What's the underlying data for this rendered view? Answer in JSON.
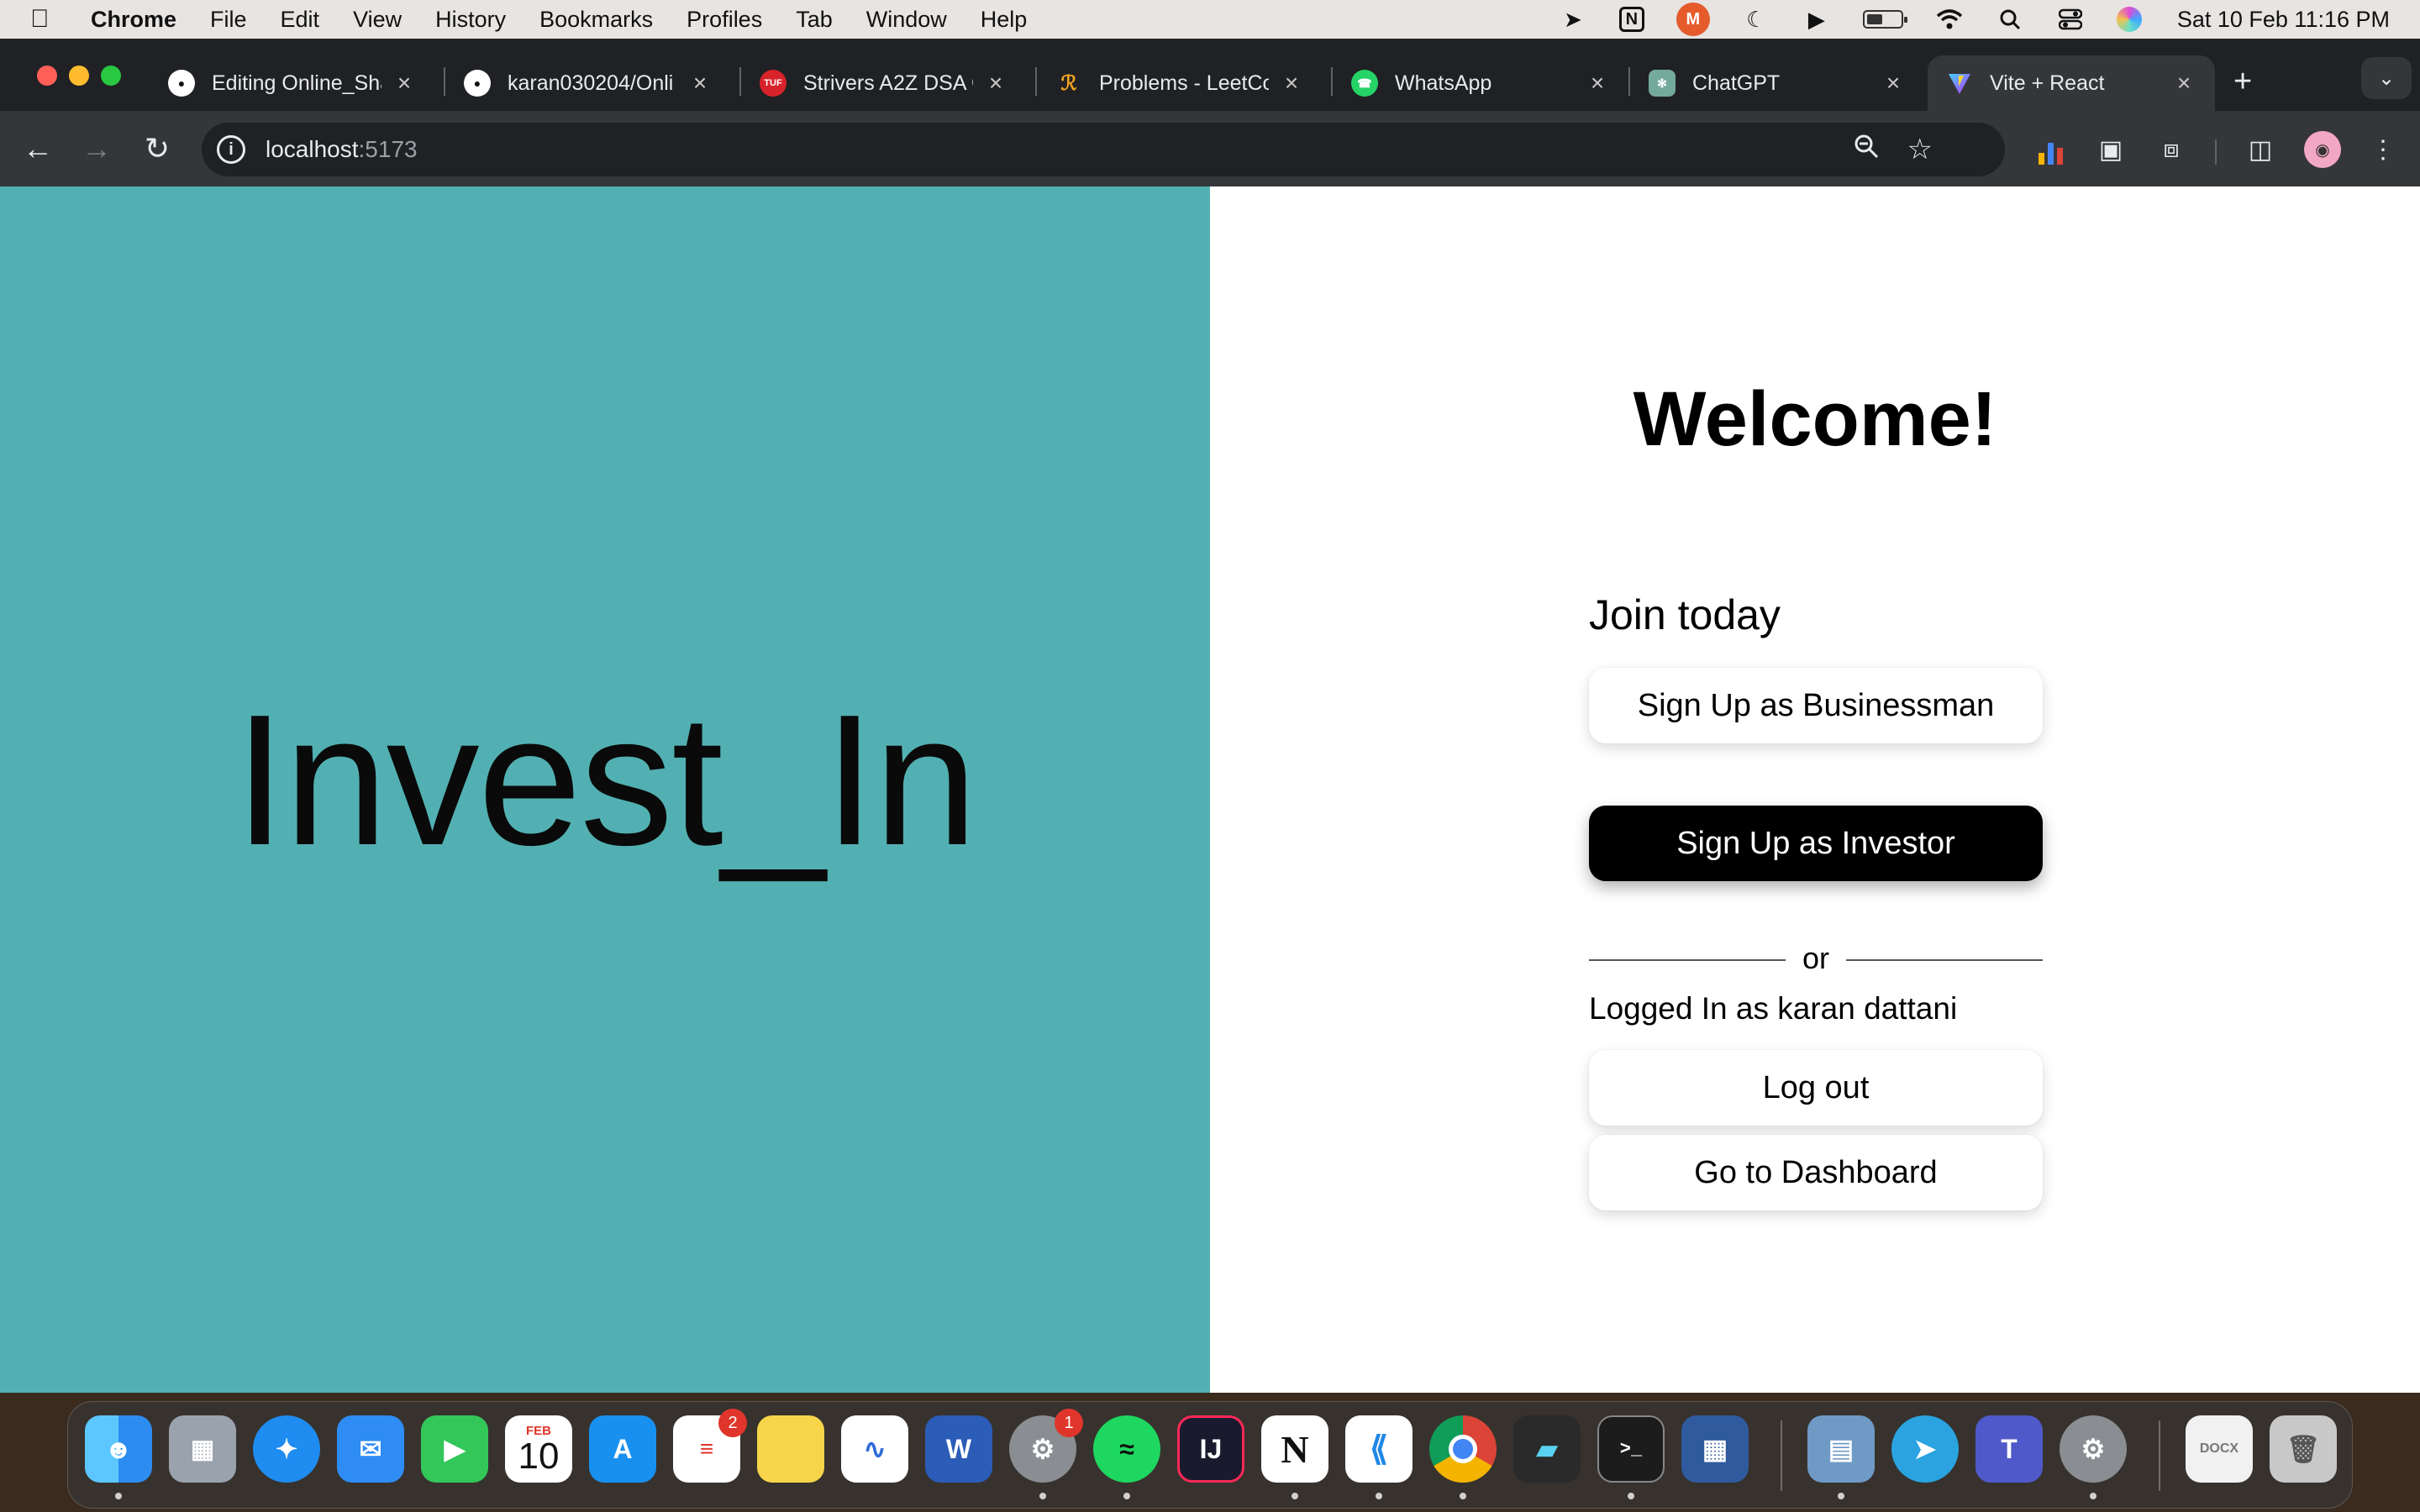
{
  "menubar": {
    "app": "Chrome",
    "items": [
      "File",
      "Edit",
      "View",
      "History",
      "Bookmarks",
      "Profiles",
      "Tab",
      "Window",
      "Help"
    ],
    "clock": "Sat 10 Feb  11:16 PM"
  },
  "tabs": [
    {
      "label": "Editing Online_Sha",
      "icon": "github-icon"
    },
    {
      "label": "karan030204/Onli",
      "icon": "github-icon"
    },
    {
      "label": "Strivers A2Z DSA C",
      "icon": "tuf-icon",
      "icon_text": "TUF"
    },
    {
      "label": "Problems - LeetCo",
      "icon": "leetcode-icon"
    },
    {
      "label": "WhatsApp",
      "icon": "whatsapp-icon"
    },
    {
      "label": "ChatGPT",
      "icon": "chatgpt-icon"
    },
    {
      "label": "Vite + React",
      "icon": "vite-icon",
      "active": true
    }
  ],
  "address": {
    "host": "localhost",
    "port": ":5173"
  },
  "page": {
    "brand": "Invest_In",
    "welcome": "Welcome!",
    "join_heading": "Join today",
    "signup_businessman": "Sign Up as Businessman",
    "or_text": "or",
    "signup_investor": "Sign Up as Investor",
    "logged_in_text": "Logged In as karan dattani",
    "logout": "Log out",
    "dashboard": "Go to Dashboard"
  },
  "colors": {
    "hero_bg": "#52b0b2",
    "primary_button": "#000000",
    "chrome_dark": "#202124",
    "chrome_toolbar": "#35363a"
  },
  "dock": {
    "calendar_month": "FEB",
    "calendar_day": "10",
    "reminders_badge": "2",
    "settings_badge": "1"
  }
}
